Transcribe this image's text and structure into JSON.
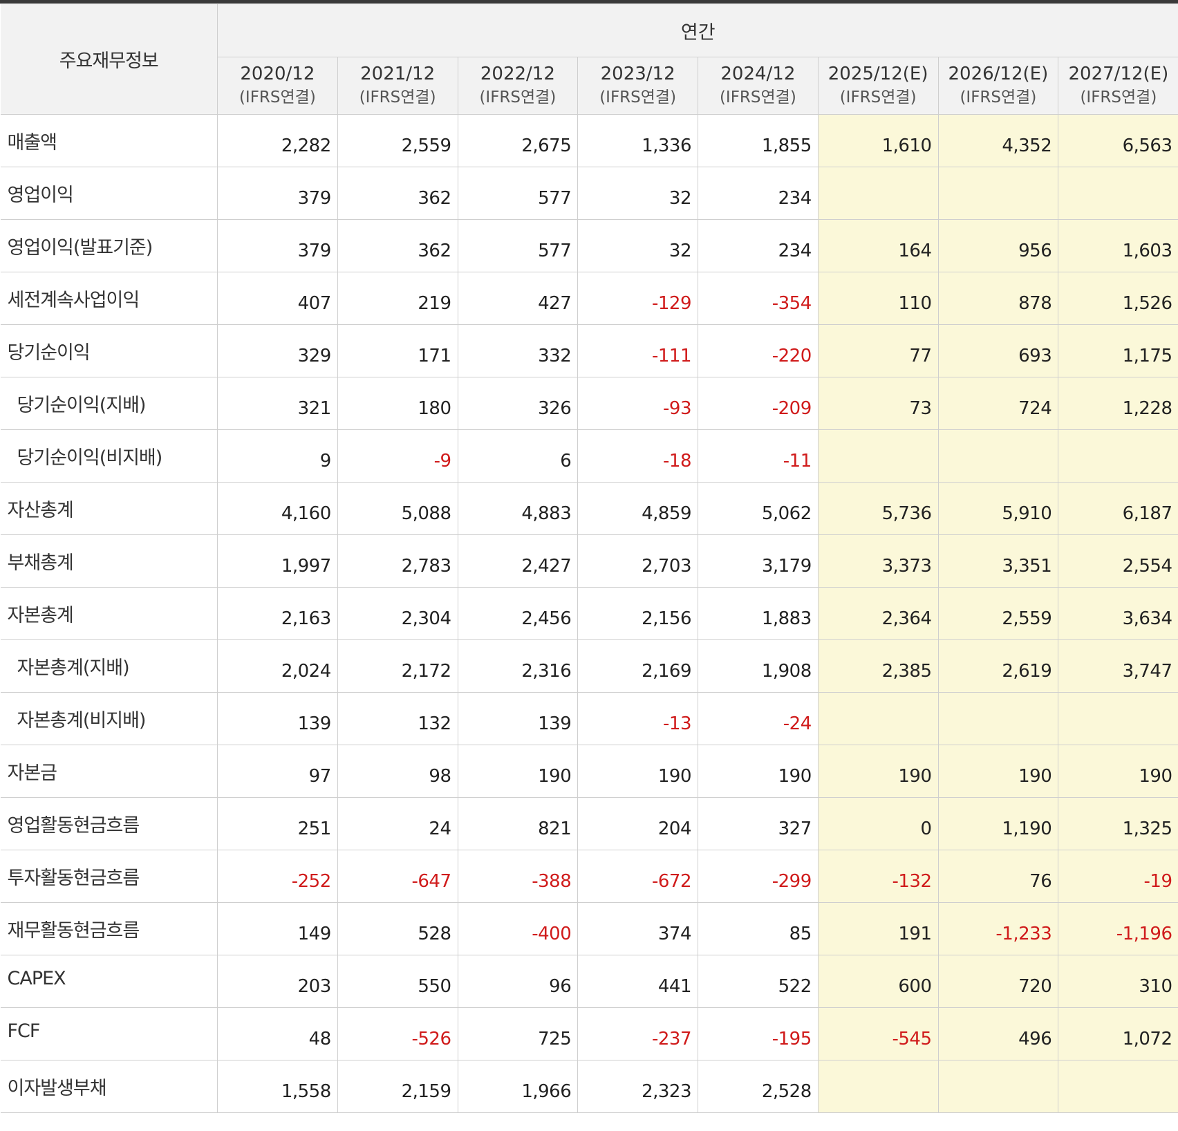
{
  "table": {
    "corner_label": "주요재무정보",
    "group_label": "연간",
    "periods": [
      {
        "year": "2020/12",
        "basis": "(IFRS연결)",
        "estimate": false
      },
      {
        "year": "2021/12",
        "basis": "(IFRS연결)",
        "estimate": false
      },
      {
        "year": "2022/12",
        "basis": "(IFRS연결)",
        "estimate": false
      },
      {
        "year": "2023/12",
        "basis": "(IFRS연결)",
        "estimate": false
      },
      {
        "year": "2024/12",
        "basis": "(IFRS연결)",
        "estimate": false
      },
      {
        "year": "2025/12(E)",
        "basis": "(IFRS연결)",
        "estimate": true
      },
      {
        "year": "2026/12(E)",
        "basis": "(IFRS연결)",
        "estimate": true
      },
      {
        "year": "2027/12(E)",
        "basis": "(IFRS연결)",
        "estimate": true
      }
    ],
    "rows": [
      {
        "label": "매출액",
        "sub": false,
        "values": [
          "2,282",
          "2,559",
          "2,675",
          "1,336",
          "1,855",
          "1,610",
          "4,352",
          "6,563"
        ]
      },
      {
        "label": "영업이익",
        "sub": false,
        "values": [
          "379",
          "362",
          "577",
          "32",
          "234",
          "",
          "",
          ""
        ]
      },
      {
        "label": "영업이익(발표기준)",
        "sub": false,
        "values": [
          "379",
          "362",
          "577",
          "32",
          "234",
          "164",
          "956",
          "1,603"
        ]
      },
      {
        "label": "세전계속사업이익",
        "sub": false,
        "values": [
          "407",
          "219",
          "427",
          "-129",
          "-354",
          "110",
          "878",
          "1,526"
        ]
      },
      {
        "label": "당기순이익",
        "sub": false,
        "values": [
          "329",
          "171",
          "332",
          "-111",
          "-220",
          "77",
          "693",
          "1,175"
        ]
      },
      {
        "label": "당기순이익(지배)",
        "sub": true,
        "values": [
          "321",
          "180",
          "326",
          "-93",
          "-209",
          "73",
          "724",
          "1,228"
        ]
      },
      {
        "label": "당기순이익(비지배)",
        "sub": true,
        "values": [
          "9",
          "-9",
          "6",
          "-18",
          "-11",
          "",
          "",
          ""
        ]
      },
      {
        "label": "자산총계",
        "sub": false,
        "values": [
          "4,160",
          "5,088",
          "4,883",
          "4,859",
          "5,062",
          "5,736",
          "5,910",
          "6,187"
        ]
      },
      {
        "label": "부채총계",
        "sub": false,
        "values": [
          "1,997",
          "2,783",
          "2,427",
          "2,703",
          "3,179",
          "3,373",
          "3,351",
          "2,554"
        ]
      },
      {
        "label": "자본총계",
        "sub": false,
        "values": [
          "2,163",
          "2,304",
          "2,456",
          "2,156",
          "1,883",
          "2,364",
          "2,559",
          "3,634"
        ]
      },
      {
        "label": "자본총계(지배)",
        "sub": true,
        "values": [
          "2,024",
          "2,172",
          "2,316",
          "2,169",
          "1,908",
          "2,385",
          "2,619",
          "3,747"
        ]
      },
      {
        "label": "자본총계(비지배)",
        "sub": true,
        "values": [
          "139",
          "132",
          "139",
          "-13",
          "-24",
          "",
          "",
          ""
        ]
      },
      {
        "label": "자본금",
        "sub": false,
        "values": [
          "97",
          "98",
          "190",
          "190",
          "190",
          "190",
          "190",
          "190"
        ]
      },
      {
        "label": "영업활동현금흐름",
        "sub": false,
        "values": [
          "251",
          "24",
          "821",
          "204",
          "327",
          "0",
          "1,190",
          "1,325"
        ]
      },
      {
        "label": "투자활동현금흐름",
        "sub": false,
        "values": [
          "-252",
          "-647",
          "-388",
          "-672",
          "-299",
          "-132",
          "76",
          "-19"
        ]
      },
      {
        "label": "재무활동현금흐름",
        "sub": false,
        "values": [
          "149",
          "528",
          "-400",
          "374",
          "85",
          "191",
          "-1,233",
          "-1,196"
        ]
      },
      {
        "label": "CAPEX",
        "sub": false,
        "values": [
          "203",
          "550",
          "96",
          "441",
          "522",
          "600",
          "720",
          "310"
        ]
      },
      {
        "label": "FCF",
        "sub": false,
        "values": [
          "48",
          "-526",
          "725",
          "-237",
          "-195",
          "-545",
          "496",
          "1,072"
        ]
      },
      {
        "label": "이자발생부채",
        "sub": false,
        "values": [
          "1,558",
          "2,159",
          "1,966",
          "2,323",
          "2,528",
          "",
          "",
          ""
        ]
      }
    ]
  },
  "colors": {
    "estimate_bg": "#fbf8d9",
    "negative": "#d01b1b",
    "header_bg": "#f2f2f2"
  }
}
